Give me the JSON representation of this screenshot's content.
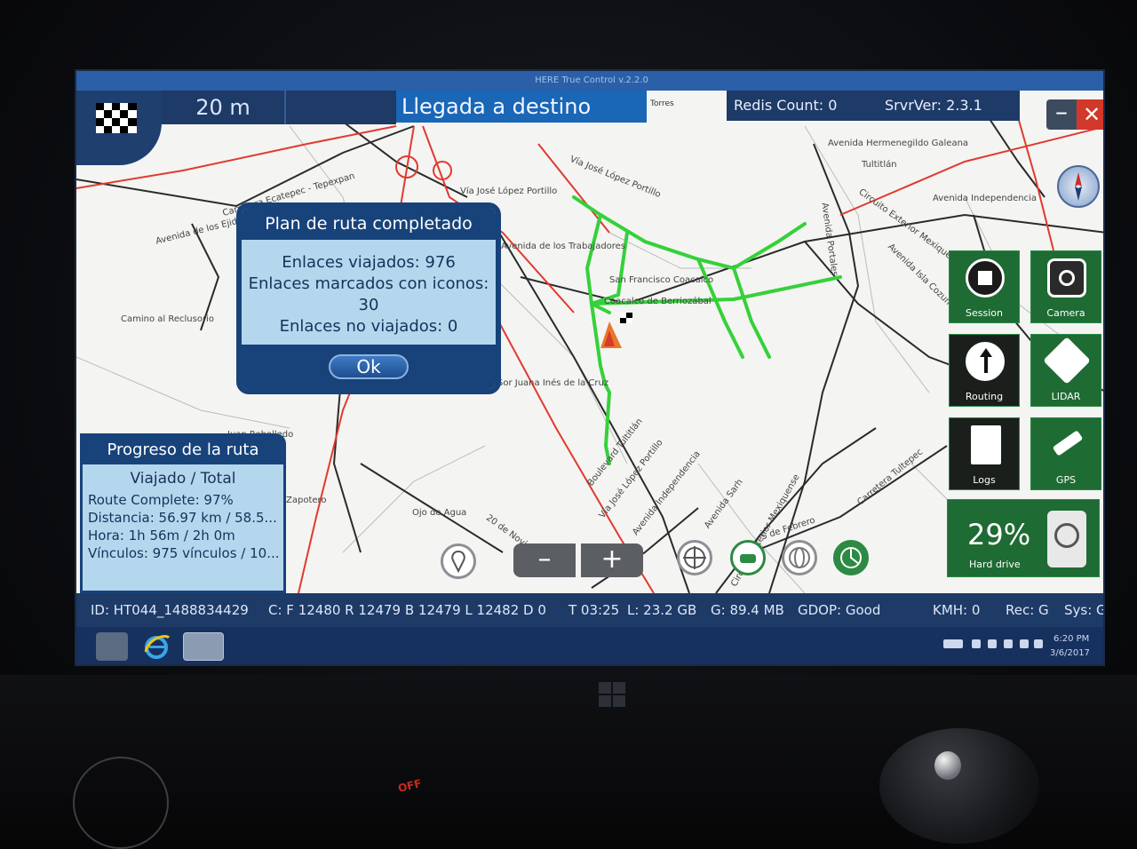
{
  "app": {
    "window_title": "HERE True Control v.2.2.0"
  },
  "top_bar": {
    "distance": "20 m",
    "instruction": "Llegada a destino",
    "street_chip": "Torres",
    "redis_count": "Redis Count: 0",
    "server_version": "SrvrVer: 2.3.1"
  },
  "map_labels": [
    "Avenida Hermenegildo Galeana",
    "Tultitlán",
    "Avenida Independencia",
    "Vía José López Portillo",
    "Vía José López Portillo",
    "Carretera Ecatepec - Tepexpan",
    "Avenida de los Ejidos",
    "Avenida de los Trabajadores",
    "San Francisco Coacalco",
    "Coacalco de Berriozábal",
    "Camino al Reclusorio",
    "Circuito Exterior Mexiquense",
    "Avenida Isla Cozumel",
    "Avenida Portales",
    "Sor Juana Inés de la Cruz",
    "Boulevard Tultitlán",
    "Vía José López Portillo",
    "Avenida Independencia",
    "Avenida Sarh",
    "Circuito Exterior Mexiquense",
    "5 de Febrero",
    "Carretera Tultepec",
    "Ojo de Agua",
    "20 de Noviembre",
    "Juan Rebolledo",
    "Zapotero"
  ],
  "dialog": {
    "title": "Plan de ruta completado",
    "line1": "Enlaces viajados: 976",
    "line2": "Enlaces marcados con iconos:",
    "line3": "30",
    "line4": "Enlaces no viajados: 0",
    "ok_label": "Ok"
  },
  "progress": {
    "title": "Progreso de la ruta",
    "subtitle": "Viajado / Total",
    "route_complete": "Route Complete: 97%",
    "distance": "Distancia: 56.97 km / 58.5...",
    "time": "Hora: 1h 56m / 2h 0m",
    "links": "Vínculos: 975 vínculos / 10..."
  },
  "tools": {
    "session": "Session",
    "camera": "Camera",
    "routing": "Routing",
    "lidar": "LIDAR",
    "logs": "Logs",
    "gps": "GPS",
    "hdd_percent": "29%",
    "hdd_label": "Hard drive",
    "hdd_level": 0.29
  },
  "status_bar": {
    "id": "ID: HT044_1488834429",
    "counts": "C: F 12480 R 12479 B 12479 L 12482 D 0",
    "time": "T 03:25",
    "lidar_storage": "L:  23.2 GB",
    "gps_storage": "G:  89.4 MB",
    "gdop": "GDOP: Good",
    "kmh": "KMH: 0",
    "rec": "Rec: G",
    "sys": "Sys: G"
  },
  "taskbar": {
    "clock_time": "6:20 PM",
    "clock_date": "3/6/2017"
  },
  "hardware": {
    "off_label": "OFF"
  },
  "colors": {
    "route_green": "#35d13a",
    "highway_red": "#e03a2e",
    "panel_blue": "#17437a",
    "tool_green": "#1e6b34"
  }
}
